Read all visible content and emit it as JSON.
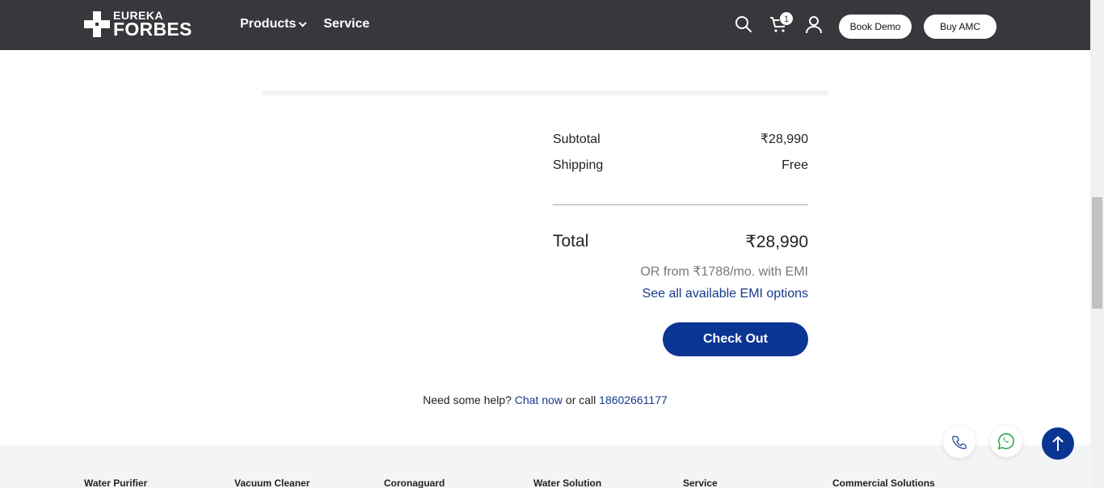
{
  "header": {
    "logo_top": "EUREKA",
    "logo_bottom": "FORBES",
    "nav": [
      {
        "label": "Products"
      },
      {
        "label": "Service"
      }
    ],
    "cart_count": "1",
    "book_demo_label": "Book Demo",
    "buy_amc_label": "Buy AMC"
  },
  "summary": {
    "subtotal_label": "Subtotal",
    "subtotal_value": "₹28,990",
    "shipping_label": "Shipping",
    "shipping_value": "Free",
    "total_label": "Total",
    "total_value": "₹28,990",
    "emi_text": "OR from ₹1788/mo. with EMI",
    "emi_link": "See all available EMI options",
    "checkout_label": "Check Out"
  },
  "help": {
    "prefix": "Need some help?",
    "chat_link": "Chat now",
    "middle": "or call",
    "phone": "18602661177"
  },
  "footer": {
    "columns": [
      "Water Purifier",
      "Vacuum Cleaner",
      "Coronaguard",
      "Water Solution",
      "Service",
      "Commercial Solutions"
    ]
  },
  "colors": {
    "header_bg": "#36383b",
    "primary_blue": "#0b3592",
    "link_blue": "#173a8c",
    "whatsapp_green": "#25a244"
  },
  "icons": {
    "search": "search-icon",
    "cart": "cart-icon",
    "user": "user-icon",
    "phone": "phone-icon",
    "whatsapp": "whatsapp-icon",
    "arrow_up": "arrow-up-icon"
  }
}
